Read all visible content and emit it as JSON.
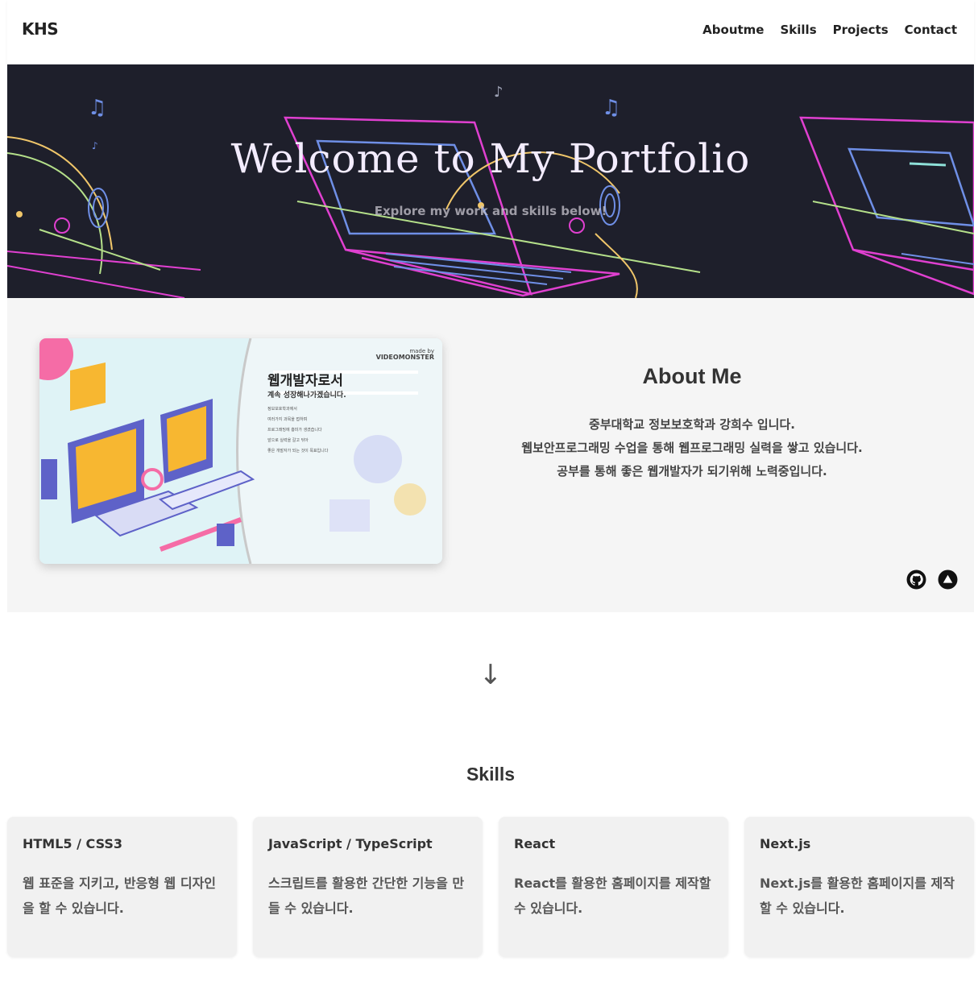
{
  "header": {
    "logo": "KHS",
    "nav": [
      "Aboutme",
      "Skills",
      "Projects",
      "Contact"
    ]
  },
  "hero": {
    "title": "Welcome to My Portfolio",
    "subtitle": "Explore my work and skills below!",
    "accent_colors": [
      "#e040d0",
      "#6f8fe6",
      "#b5e08a",
      "#f0c66a"
    ]
  },
  "about": {
    "image": {
      "title": "웹개발자로서",
      "subtitle": "계속 성장해나가겠습니다.",
      "made_by_small": "made by",
      "made_by_brand": "VIDEOMONSTER",
      "lines": [
        "정보보호학과에서",
        "여러가지 과목을 접하며",
        "프로그래밍에 흥미가 생겼습니다",
        "앞으로 실력을 갈고 닦아",
        "좋은 개발자가 되는 것이 목표입니다"
      ]
    },
    "title": "About Me",
    "lines": [
      "중부대학교 정보보호학과 강희수 입니다.",
      "웹보안프로그래밍 수업을 통해 웹프로그래밍 실력을 쌓고 있습니다.",
      "공부를 통해 좋은 웹개발자가 되기위해 노력중입니다."
    ],
    "social_icons": [
      "github-icon",
      "up-triangle-icon"
    ]
  },
  "scroll_arrow": "↓",
  "skills": {
    "title": "Skills",
    "cards": [
      {
        "name": "HTML5 / CSS3",
        "desc": "웹 표준을 지키고, 반응형 웹 디자인을 할 수 있습니다."
      },
      {
        "name": "JavaScript / TypeScript",
        "desc": "스크립트를 활용한 간단한 기능을 만들 수 있습니다."
      },
      {
        "name": "React",
        "desc": "React를 활용한 홈페이지를 제작할 수 있습니다."
      },
      {
        "name": "Next.js",
        "desc": "Next.js를 활용한 홈페이지를 제작할 수 있습니다."
      }
    ]
  }
}
